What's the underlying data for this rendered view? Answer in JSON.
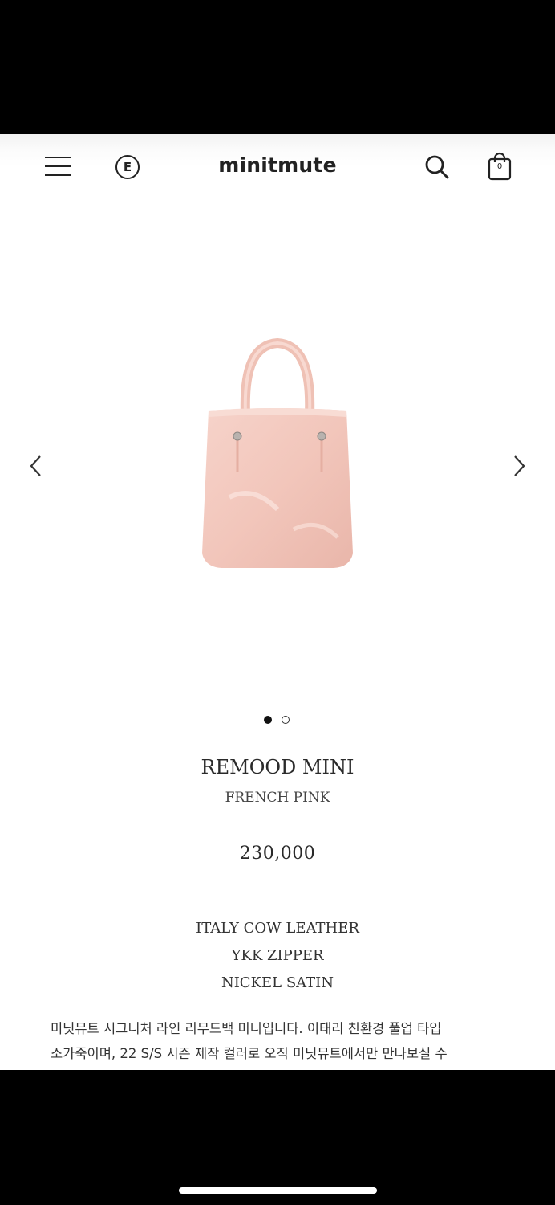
{
  "header": {
    "brand_badge": "E",
    "logo": "minitmute",
    "cart_count": "0",
    "icons": {
      "menu": "menu-icon",
      "badge": "e-badge-icon",
      "search": "search-icon",
      "cart": "shopping-bag-icon"
    }
  },
  "gallery": {
    "prev_icon": "chevron-left-icon",
    "next_icon": "chevron-right-icon",
    "image_color": "#f0c7bd",
    "slide_count": 2,
    "active_slide": 1
  },
  "product": {
    "name": "REMOOD MINI",
    "color": "FRENCH PINK",
    "price": "230,000",
    "specs": [
      "ITALY COW LEATHER",
      "YKK ZIPPER",
      "NICKEL SATIN"
    ],
    "description_lines": [
      "미닛뮤트 시그니처 라인 리무드백 미니입니다. 이태리 친환경 풀업 타입",
      "소가죽이며, 22 S/S 시즌 제작 컬러로 오직 미닛뮤트에서만 만나보실 수"
    ]
  }
}
